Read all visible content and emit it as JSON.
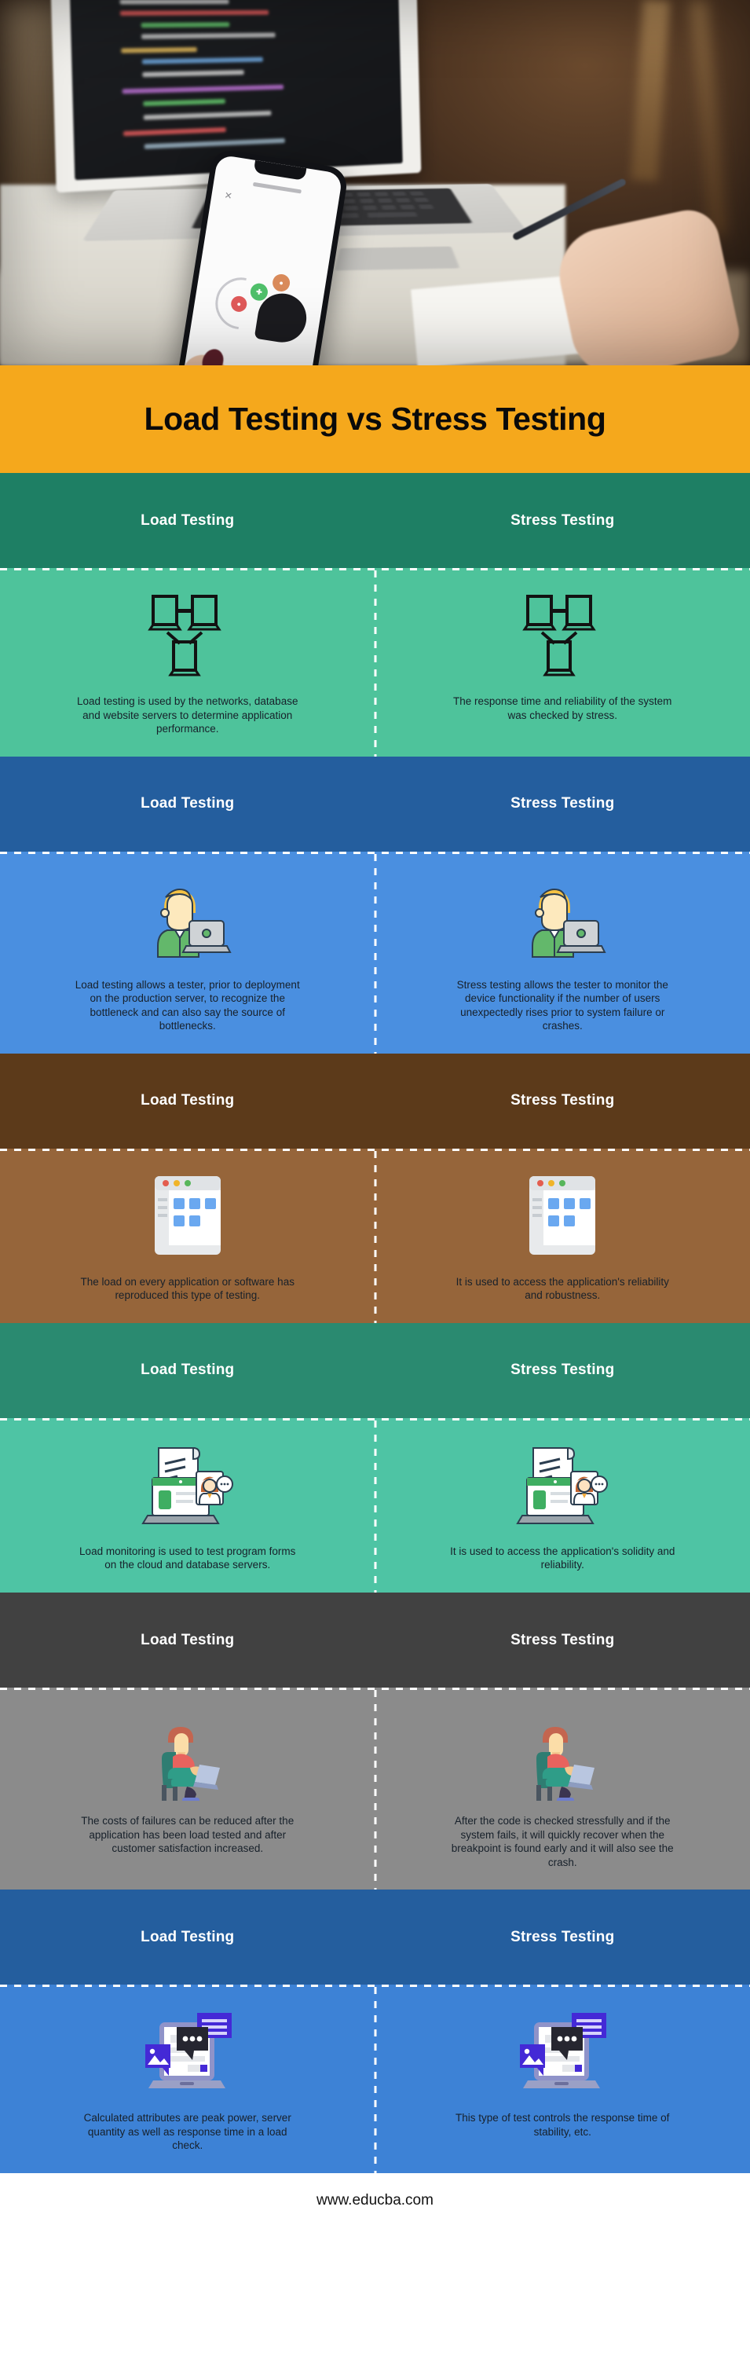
{
  "title": "Load Testing vs Stress Testing",
  "colors": {
    "title_bar": "#f5a81c",
    "green_header": "#1e7f64",
    "green_body": "#4ec39b",
    "blue_header": "#245e9e",
    "blue_body": "#4a8fe0",
    "brown_header": "#5c3a1a",
    "brown_body": "#96653a",
    "teal_header": "#2a8a70",
    "teal_body": "#4ec4a4",
    "gray_header": "#414141",
    "gray_body": "#8b8b8b",
    "blue2_header": "#245e9e",
    "blue2_body": "#3d82d6",
    "footer_bg": "#ffffff",
    "header_text": "#ffffff",
    "body_text": "#17202a"
  },
  "column_headers": {
    "left": "Load Testing",
    "right": "Stress Testing"
  },
  "sections": [
    {
      "id": "section-1",
      "theme": "green",
      "icon": "connected-monitors-icon",
      "left_text": "Load testing is used by the networks, database and website servers to determine application performance.",
      "right_text": "The response time and reliability of the system was checked by stress."
    },
    {
      "id": "section-2",
      "theme": "blue",
      "icon": "person-with-laptop-icon",
      "left_text": "Load testing allows a tester, prior to deployment on the production server, to recognize the bottleneck and can also say the source of bottlenecks.",
      "right_text": "Stress testing allows the tester to monitor the device functionality if the number of users unexpectedly rises prior to system failure or crashes."
    },
    {
      "id": "section-3",
      "theme": "brown",
      "icon": "browser-window-icon",
      "left_text": "The load on every application or software has reproduced this type of testing.",
      "right_text": "It is used to access the application's reliability and robustness."
    },
    {
      "id": "section-4",
      "theme": "teal",
      "icon": "laptop-document-support-icon",
      "left_text": "Load monitoring is used to test program forms on the cloud and database servers.",
      "right_text": "It is used to access the application's solidity and reliability."
    },
    {
      "id": "section-5",
      "theme": "gray",
      "icon": "seated-person-laptop-icon",
      "left_text": "The costs of failures can be reduced after the application has been load tested and after customer satisfaction increased.",
      "right_text": "After the code is checked stressfully and if the system fails, it will quickly recover when the breakpoint is found early and it will also see the crash."
    },
    {
      "id": "section-6",
      "theme": "blue2",
      "icon": "laptop-chat-bubbles-icon",
      "left_text": "Calculated attributes are peak power, server quantity as well as response time in a load check.",
      "right_text": "This type of test controls the response time of stability, etc."
    }
  ],
  "footer": {
    "url": "www.educba.com"
  }
}
